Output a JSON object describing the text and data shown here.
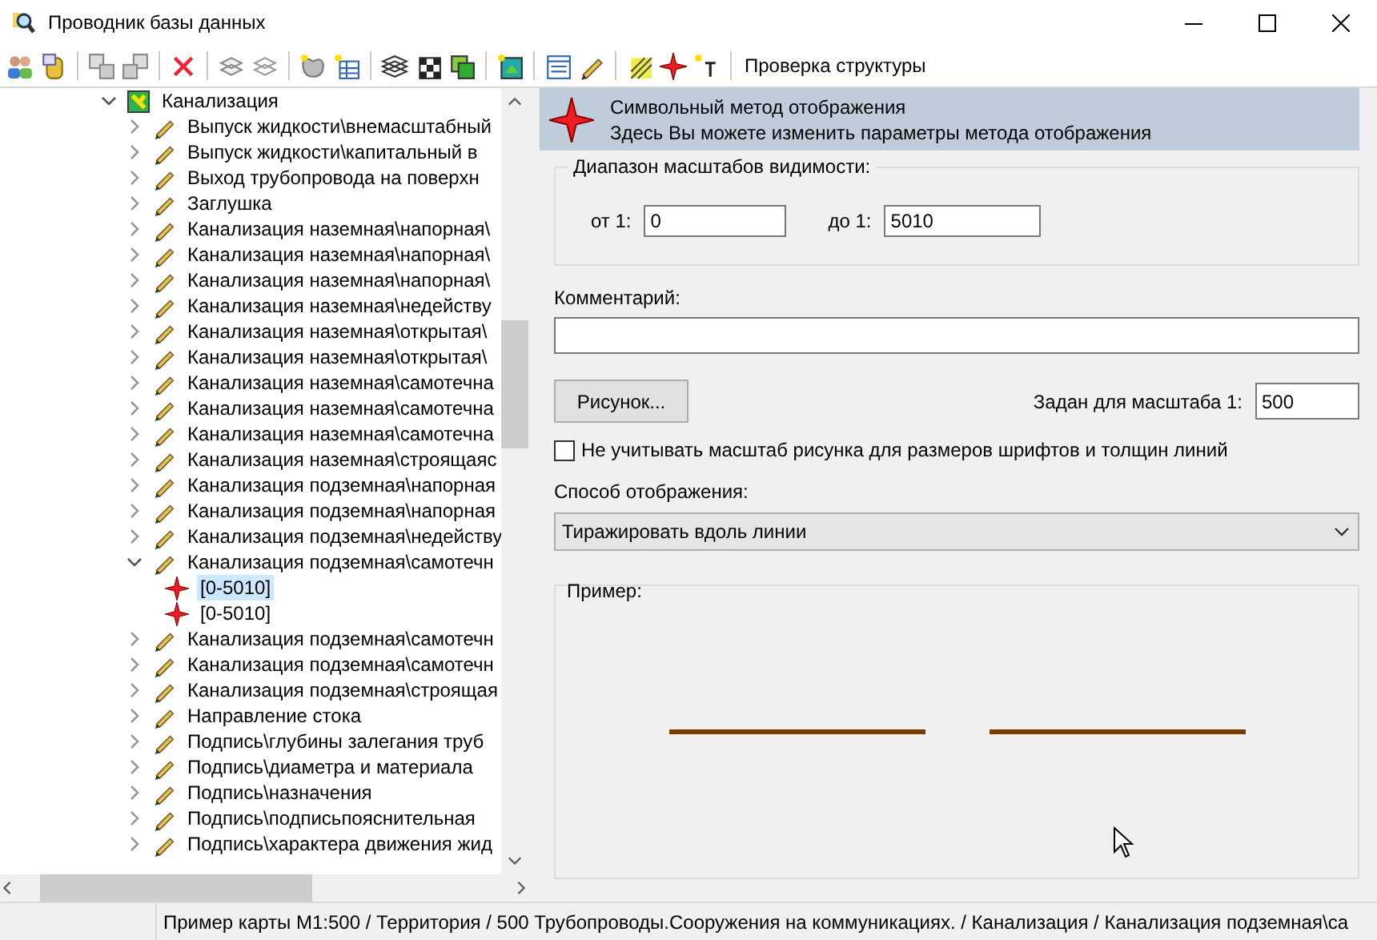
{
  "window": {
    "title": "Проводник базы данных"
  },
  "toolbar": {
    "label": "Проверка структуры"
  },
  "tree": {
    "root": {
      "label": "Канализация",
      "kind": "layer",
      "expanded": true,
      "children": [
        {
          "label": "Выпуск жидкости\\внемасштабный",
          "kind": "style",
          "expanded": false,
          "selected": false
        },
        {
          "label": "Выпуск жидкости\\капитальный в",
          "kind": "style",
          "expanded": false,
          "selected": false
        },
        {
          "label": "Выход трубопровода на поверхн",
          "kind": "style",
          "expanded": false,
          "selected": false
        },
        {
          "label": "Заглушка",
          "kind": "style",
          "expanded": false,
          "selected": false
        },
        {
          "label": "Канализация наземная\\напорная\\",
          "kind": "style",
          "expanded": false,
          "selected": false
        },
        {
          "label": "Канализация наземная\\напорная\\",
          "kind": "style",
          "expanded": false,
          "selected": false
        },
        {
          "label": "Канализация наземная\\напорная\\",
          "kind": "style",
          "expanded": false,
          "selected": false
        },
        {
          "label": "Канализация наземная\\недейству",
          "kind": "style",
          "expanded": false,
          "selected": false
        },
        {
          "label": "Канализация наземная\\открытая\\",
          "kind": "style",
          "expanded": false,
          "selected": false
        },
        {
          "label": "Канализация наземная\\открытая\\",
          "kind": "style",
          "expanded": false,
          "selected": false
        },
        {
          "label": "Канализация наземная\\самотечна",
          "kind": "style",
          "expanded": false,
          "selected": false
        },
        {
          "label": "Канализация наземная\\самотечна",
          "kind": "style",
          "expanded": false,
          "selected": false
        },
        {
          "label": "Канализация наземная\\самотечна",
          "kind": "style",
          "expanded": false,
          "selected": false
        },
        {
          "label": "Канализация наземная\\строящаяс",
          "kind": "style",
          "expanded": false,
          "selected": false
        },
        {
          "label": "Канализация подземная\\напорная",
          "kind": "style",
          "expanded": false,
          "selected": false
        },
        {
          "label": "Канализация подземная\\напорная",
          "kind": "style",
          "expanded": false,
          "selected": false
        },
        {
          "label": "Канализация подземная\\недейству",
          "kind": "style",
          "expanded": false,
          "selected": false
        },
        {
          "label": "Канализация подземная\\самотечн",
          "kind": "style",
          "expanded": true,
          "selected": false,
          "children": [
            {
              "label": "[0-5010]",
              "kind": "symbol",
              "selected": true
            },
            {
              "label": "[0-5010]",
              "kind": "symbol",
              "selected": false
            }
          ]
        },
        {
          "label": "Канализация подземная\\самотечн",
          "kind": "style",
          "expanded": false,
          "selected": false
        },
        {
          "label": "Канализация подземная\\самотечн",
          "kind": "style",
          "expanded": false,
          "selected": false
        },
        {
          "label": "Канализация подземная\\строящая",
          "kind": "style",
          "expanded": false,
          "selected": false
        },
        {
          "label": "Направление стока",
          "kind": "style",
          "expanded": false,
          "selected": false
        },
        {
          "label": "Подпись\\глубины залегания труб",
          "kind": "style",
          "expanded": false,
          "selected": false
        },
        {
          "label": "Подпись\\диаметра и материала",
          "kind": "style",
          "expanded": false,
          "selected": false
        },
        {
          "label": "Подпись\\назначения",
          "kind": "style",
          "expanded": false,
          "selected": false
        },
        {
          "label": "Подпись\\подписьпояснительная",
          "kind": "style",
          "expanded": false,
          "selected": false
        },
        {
          "label": "Подпись\\характера движения жид",
          "kind": "style",
          "expanded": false,
          "selected": false
        }
      ]
    }
  },
  "panel": {
    "header": {
      "title": "Символьный метод отображения",
      "subtitle": "Здесь Вы можете изменить параметры метода отображения"
    },
    "range": {
      "legend": "Диапазон масштабов видимости:",
      "from_label": "от 1:",
      "from_value": "0",
      "to_label": "до 1:",
      "to_value": "5010"
    },
    "comment": {
      "label": "Комментарий:"
    },
    "picture_button": "Рисунок...",
    "scale": {
      "label": "Задан для масштаба 1:",
      "value": "500"
    },
    "ignore_scale": {
      "label": "Не учитывать масштаб рисунка для размеров шрифтов и толщин линий",
      "checked": false
    },
    "display_mode": {
      "label": "Способ отображения:",
      "value": "Тиражировать вдоль линии"
    },
    "preview": {
      "legend": "Пример:"
    }
  },
  "status_bar": {
    "text": "Пример карты М1:500 / Территория / 500 Трубопроводы.Сооружения на коммуникациях. / Канализация / Канализация подземная\\са"
  }
}
